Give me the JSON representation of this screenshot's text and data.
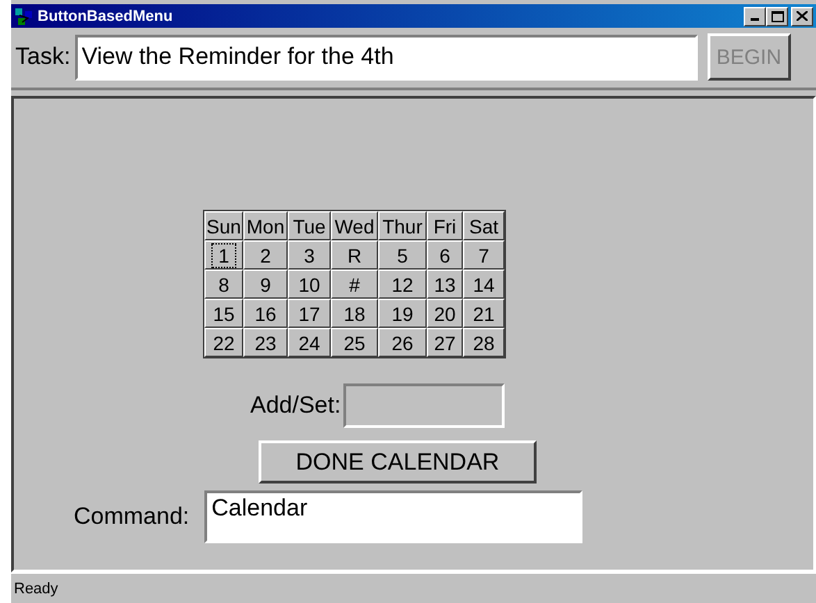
{
  "window": {
    "title": "ButtonBasedMenu"
  },
  "task": {
    "label": "Task:",
    "value": "View the Reminder for the 4th"
  },
  "begin_button": {
    "label": "BEGIN",
    "disabled": true
  },
  "calendar": {
    "headers": [
      "Sun",
      "Mon",
      "Tue",
      "Wed",
      "Thur",
      "Fri",
      "Sat"
    ],
    "rows": [
      [
        {
          "label": "1",
          "focused": true
        },
        {
          "label": "2",
          "focused": false
        },
        {
          "label": "3",
          "focused": false
        },
        {
          "label": "R",
          "focused": false
        },
        {
          "label": "5",
          "focused": false
        },
        {
          "label": "6",
          "focused": false
        },
        {
          "label": "7",
          "focused": false
        }
      ],
      [
        {
          "label": "8",
          "focused": false
        },
        {
          "label": "9",
          "focused": false
        },
        {
          "label": "10",
          "focused": false
        },
        {
          "label": "#",
          "focused": false
        },
        {
          "label": "12",
          "focused": false
        },
        {
          "label": "13",
          "focused": false
        },
        {
          "label": "14",
          "focused": false
        }
      ],
      [
        {
          "label": "15",
          "focused": false
        },
        {
          "label": "16",
          "focused": false
        },
        {
          "label": "17",
          "focused": false
        },
        {
          "label": "18",
          "focused": false
        },
        {
          "label": "19",
          "focused": false
        },
        {
          "label": "20",
          "focused": false
        },
        {
          "label": "21",
          "focused": false
        }
      ],
      [
        {
          "label": "22",
          "focused": false
        },
        {
          "label": "23",
          "focused": false
        },
        {
          "label": "24",
          "focused": false
        },
        {
          "label": "25",
          "focused": false
        },
        {
          "label": "26",
          "focused": false
        },
        {
          "label": "27",
          "focused": false
        },
        {
          "label": "28",
          "focused": false
        }
      ]
    ]
  },
  "add_set": {
    "label": "Add/Set:",
    "disabled": true
  },
  "done_button": {
    "label": "DONE CALENDAR"
  },
  "command": {
    "label": "Command:",
    "value": "Calendar"
  },
  "status_bar": {
    "text": "Ready"
  }
}
